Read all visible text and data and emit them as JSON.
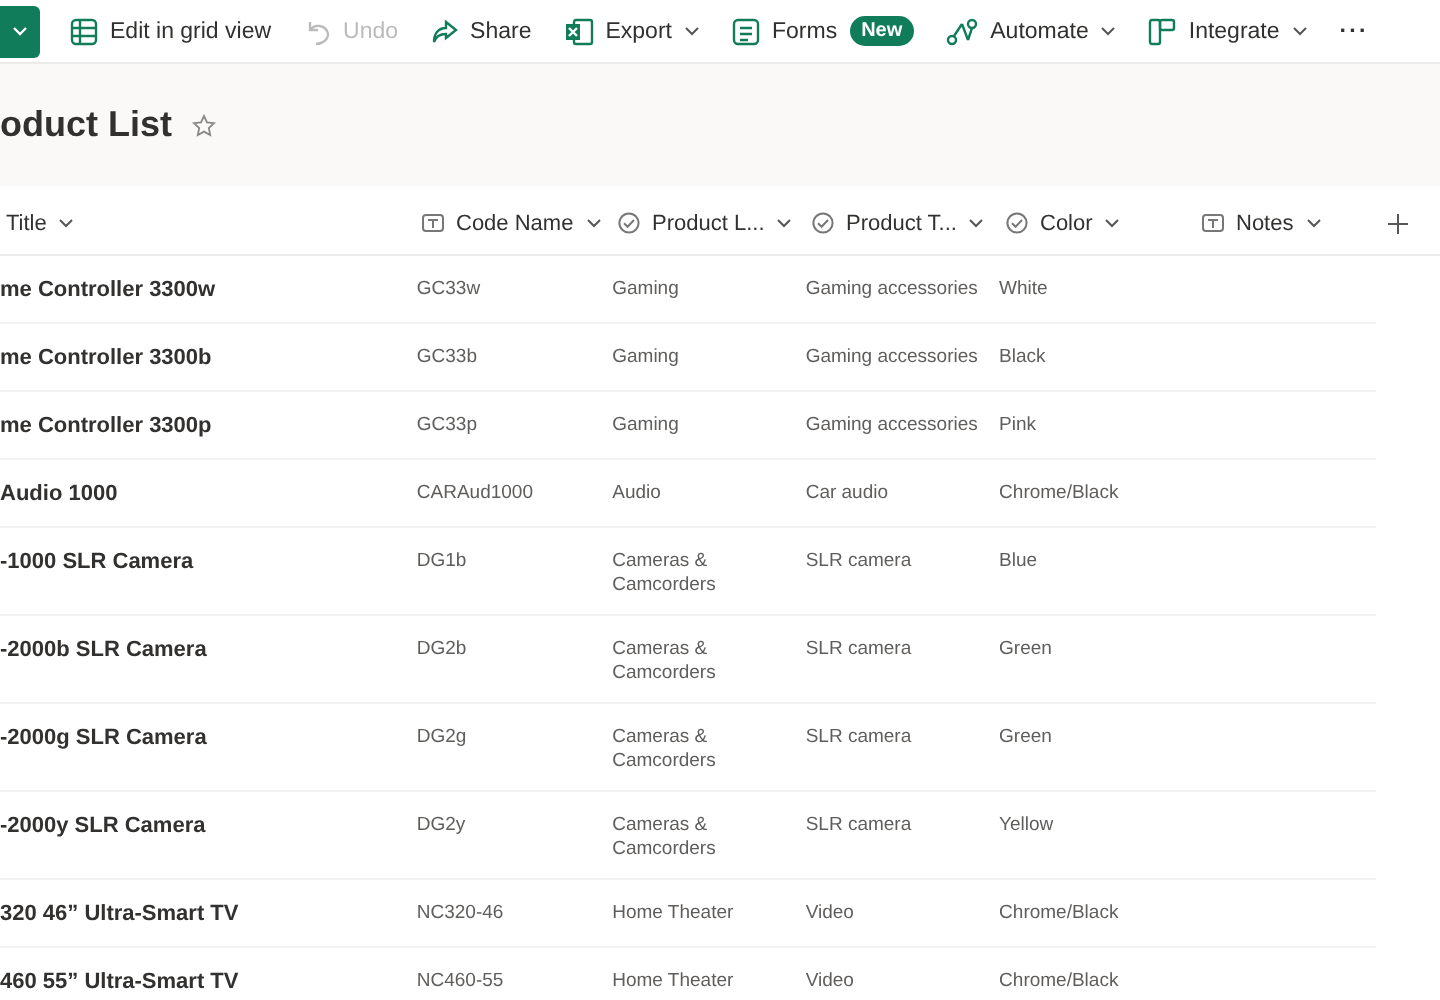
{
  "toolbar": {
    "items": [
      {
        "kind": "new-menu"
      },
      {
        "kind": "grid",
        "label": "Edit in grid view",
        "disabled": false,
        "dropdown": false
      },
      {
        "kind": "undo",
        "label": "Undo",
        "disabled": true,
        "dropdown": false
      },
      {
        "kind": "share",
        "label": "Share",
        "disabled": false,
        "dropdown": false
      },
      {
        "kind": "export",
        "label": "Export",
        "disabled": false,
        "dropdown": true
      },
      {
        "kind": "forms",
        "label": "Forms",
        "badge": "New",
        "disabled": false,
        "dropdown": false
      },
      {
        "kind": "automate",
        "label": "Automate",
        "disabled": false,
        "dropdown": true
      },
      {
        "kind": "integrate",
        "label": "Integrate",
        "disabled": false,
        "dropdown": true
      },
      {
        "kind": "more",
        "label": "···",
        "disabled": false,
        "dropdown": false
      }
    ]
  },
  "list": {
    "title": "oduct List",
    "favorite": false
  },
  "table": {
    "columns": [
      {
        "label": "Title",
        "kind": "title"
      },
      {
        "label": "Code Name",
        "kind": "text"
      },
      {
        "label": "Product L...",
        "kind": "choice"
      },
      {
        "label": "Product T...",
        "kind": "choice"
      },
      {
        "label": "Color",
        "kind": "choice"
      },
      {
        "label": "Notes",
        "kind": "text"
      }
    ],
    "rows": [
      {
        "cells": [
          "me Controller 3300w",
          "GC33w",
          "Gaming",
          "Gaming accessories",
          "White",
          ""
        ]
      },
      {
        "cells": [
          "me Controller 3300b",
          "GC33b",
          "Gaming",
          "Gaming accessories",
          "Black",
          ""
        ]
      },
      {
        "cells": [
          "me Controller 3300p",
          "GC33p",
          "Gaming",
          "Gaming accessories",
          "Pink",
          ""
        ]
      },
      {
        "cells": [
          "Audio 1000",
          "CARAud1000",
          "Audio",
          "Car audio",
          "Chrome/Black",
          ""
        ]
      },
      {
        "cells": [
          "-1000 SLR Camera",
          "DG1b",
          "Cameras & Camcorders",
          "SLR camera",
          "Blue",
          ""
        ]
      },
      {
        "cells": [
          "-2000b SLR Camera",
          "DG2b",
          "Cameras & Camcorders",
          "SLR camera",
          "Green",
          ""
        ]
      },
      {
        "cells": [
          "-2000g SLR Camera",
          "DG2g",
          "Cameras & Camcorders",
          "SLR camera",
          "Green",
          ""
        ]
      },
      {
        "cells": [
          "-2000y SLR Camera",
          "DG2y",
          "Cameras & Camcorders",
          "SLR camera",
          "Yellow",
          ""
        ]
      },
      {
        "cells": [
          "320 46” Ultra-Smart TV",
          "NC320-46",
          "Home Theater",
          "Video",
          "Chrome/Black",
          ""
        ]
      },
      {
        "cells": [
          "460 55” Ultra-Smart TV",
          "NC460-55",
          "Home Theater",
          "Video",
          "Chrome/Black",
          ""
        ]
      }
    ]
  }
}
